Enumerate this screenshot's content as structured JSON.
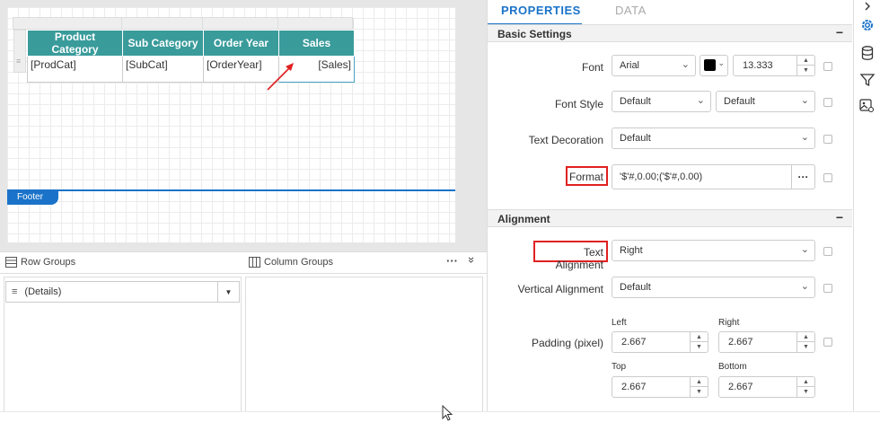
{
  "tablix": {
    "headers": [
      "Product Category",
      "Sub Category",
      "Order Year",
      "Sales"
    ],
    "cells": [
      "[ProdCat]",
      "[SubCat]",
      "[OrderYear]",
      "[Sales]"
    ]
  },
  "footer_label": "Footer",
  "groups": {
    "row_groups_label": "Row Groups",
    "column_groups_label": "Column Groups",
    "more_label": "···",
    "expand_label": "»",
    "details_label": "(Details)"
  },
  "tabs": {
    "properties": "PROPERTIES",
    "data": "DATA"
  },
  "basic_settings": {
    "title": "Basic Settings",
    "collapse": "−",
    "font_label": "Font",
    "font_value": "Arial",
    "font_color": "#000000",
    "font_size": "13.333",
    "font_style_label": "Font Style",
    "font_style_value": "Default",
    "font_weight_value": "Default",
    "text_decoration_label": "Text Decoration",
    "text_decoration_value": "Default",
    "format_label": "Format",
    "format_value": "'$'#,0.00;('$'#,0.00)",
    "format_more": "···"
  },
  "alignment": {
    "title": "Alignment",
    "collapse": "−",
    "text_alignment_label": "Text Alignment",
    "text_alignment_value": "Right",
    "vertical_alignment_label": "Vertical Alignment",
    "vertical_alignment_value": "Default",
    "padding_label": "Padding (pixel)",
    "left_label": "Left",
    "right_label": "Right",
    "top_label": "Top",
    "bottom_label": "Bottom",
    "left_value": "2.667",
    "right_value": "2.667",
    "top_value": "2.667",
    "bottom_value": "2.667"
  },
  "colors": {
    "accent": "#1a73c9",
    "header_teal": "#3a9b9b",
    "highlight": "#e02020"
  },
  "sidebar_icons": [
    "chevron-right-icon",
    "gear-icon",
    "database-icon",
    "filter-icon",
    "image-settings-icon"
  ]
}
